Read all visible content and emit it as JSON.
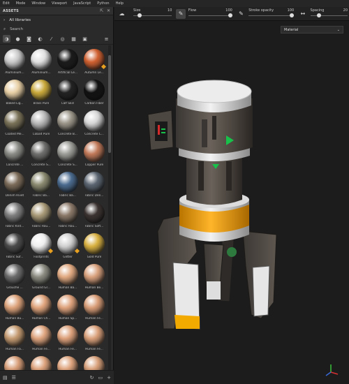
{
  "menu": [
    "Edit",
    "Mode",
    "Window",
    "Viewport",
    "JavaScript",
    "Python",
    "Help"
  ],
  "assets_panel": {
    "title": "ASSETS",
    "breadcrumb": "All libraries",
    "search_placeholder": "Search",
    "filter_icons": [
      "all-icon",
      "materials-icon",
      "textures-icon",
      "smart-materials-icon",
      "brush-icon",
      "particles-icon",
      "environment-icon",
      "image-icon"
    ],
    "materials": [
      {
        "label": "Aluminium...",
        "color": "#c9c9c9"
      },
      {
        "label": "Aluminium...",
        "color": "#e0e0e0"
      },
      {
        "label": "Artificial Le...",
        "color": "#1a1a1a"
      },
      {
        "label": "Autumn Le...",
        "color": "#d06030",
        "badge": true
      },
      {
        "label": "Baked Lig...",
        "color": "#e7cfa5"
      },
      {
        "label": "Brass Pure",
        "color": "#c8a83a"
      },
      {
        "label": "Calf Skin",
        "color": "#222222"
      },
      {
        "label": "Carbon Fiber",
        "color": "#111111"
      },
      {
        "label": "Coated Me...",
        "color": "#7a7258"
      },
      {
        "label": "Cobalt Pure",
        "color": "#b8b8b8"
      },
      {
        "label": "Concrete B...",
        "color": "#9a9488"
      },
      {
        "label": "Concrete C...",
        "color": "#d6d6d6"
      },
      {
        "label": "Concrete ...",
        "color": "#8a8a86"
      },
      {
        "label": "Concrete S...",
        "color": "#6e6e6c"
      },
      {
        "label": "Concrete S...",
        "color": "#9a9a96"
      },
      {
        "label": "Copper Pure",
        "color": "#c07858"
      },
      {
        "label": "Denim Rivet",
        "color": "#7a6a58"
      },
      {
        "label": "Fabric Ba...",
        "color": "#8a8a70"
      },
      {
        "label": "Fabric Ba...",
        "color": "#4a6a8e"
      },
      {
        "label": "Fabric Den...",
        "color": "#5a6470"
      },
      {
        "label": "Fabric Knit...",
        "color": "#7e7e7e"
      },
      {
        "label": "Fabric Rou...",
        "color": "#a89a78"
      },
      {
        "label": "Fabric Rou...",
        "color": "#8a7868"
      },
      {
        "label": "Fabric Soft...",
        "color": "#3a3230"
      },
      {
        "label": "Fabric Suf...",
        "color": "#4a4a4a"
      },
      {
        "label": "Footprints",
        "color": "#eeeeee",
        "badge": true
      },
      {
        "label": "Glitter",
        "color": "#d0d0d0",
        "badge": true
      },
      {
        "label": "Gold Pure",
        "color": "#d8b040"
      },
      {
        "label": "Grouche ...",
        "color": "#6a6a6a"
      },
      {
        "label": "Ground Gr...",
        "color": "#8a8a80"
      },
      {
        "label": "Human Ba...",
        "color": "#e0a880"
      },
      {
        "label": "Human Be...",
        "color": "#d8a07c"
      },
      {
        "label": "Human Bu...",
        "color": "#dca27a"
      },
      {
        "label": "Human Ch...",
        "color": "#e0a47c"
      },
      {
        "label": "Human Sp...",
        "color": "#dea27c"
      },
      {
        "label": "Human Fe...",
        "color": "#d89c76"
      },
      {
        "label": "Human Fa...",
        "color": "#c49a70"
      },
      {
        "label": "Human Fe...",
        "color": "#dea47e"
      },
      {
        "label": "Human Fe...",
        "color": "#dca07a"
      },
      {
        "label": "Human Fe...",
        "color": "#daa07a"
      },
      {
        "label": "Human Fe...",
        "color": "#d89e78"
      },
      {
        "label": "Human Fe...",
        "color": "#dca27c"
      },
      {
        "label": "Human Fe...",
        "color": "#dea47e"
      },
      {
        "label": "Human Fe...",
        "color": "#d8a07a"
      }
    ]
  },
  "toolbar": {
    "size_label": "Size",
    "size_value": "10",
    "size_level": 0.12,
    "flow_label": "Flow",
    "flow_value": "100",
    "flow_level": 1.0,
    "stroke_label": "Stroke opacity",
    "stroke_value": "100",
    "stroke_level": 1.0,
    "spacing_label": "Spacing",
    "spacing_value": "20",
    "spacing_level": 0.2
  },
  "material_dropdown": "Material",
  "colors": {
    "accent_orange": "#f4a400",
    "indicator_green": "#18c24a",
    "badge_orange": "#e8a020"
  }
}
